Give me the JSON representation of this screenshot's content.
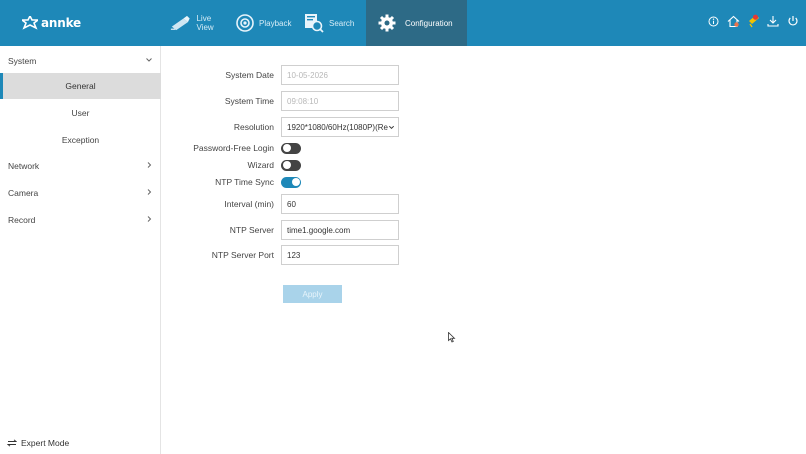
{
  "brand": {
    "logo_text": "annke"
  },
  "nav": {
    "live_view": "Live View",
    "playback": "Playback",
    "search": "Search",
    "configuration": "Configuration"
  },
  "top_icons": [
    "info-icon",
    "home-icon",
    "alarm-icon",
    "download-icon",
    "power-icon"
  ],
  "sidebar": {
    "system": "System",
    "general": "General",
    "user": "User",
    "exception": "Exception",
    "network": "Network",
    "camera": "Camera",
    "record": "Record",
    "expert_mode": "Expert Mode"
  },
  "form": {
    "system_date": {
      "label": "System Date",
      "value": "10-05-2026"
    },
    "system_time": {
      "label": "System Time",
      "value": "09:08:10"
    },
    "resolution": {
      "label": "Resolution",
      "value": "1920*1080/60Hz(1080P)(Re"
    },
    "password_free_login": {
      "label": "Password-Free Login",
      "enabled": false
    },
    "wizard": {
      "label": "Wizard",
      "enabled": false
    },
    "ntp_time_sync": {
      "label": "NTP Time Sync",
      "enabled": true
    },
    "interval": {
      "label": "Interval (min)",
      "value": "60"
    },
    "ntp_server": {
      "label": "NTP Server",
      "value": "time1.google.com"
    },
    "ntp_server_port": {
      "label": "NTP Server Port",
      "value": "123"
    },
    "apply_label": "Apply"
  },
  "colors": {
    "accent": "#1e88b8",
    "active_tab": "#2d6a86",
    "toggle_off": "#444444",
    "apply_disabled": "#a9d3ea"
  }
}
